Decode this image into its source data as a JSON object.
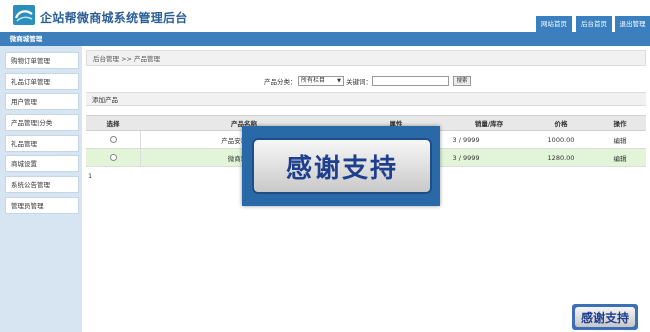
{
  "header": {
    "title": "企站帮微商城系统管理后台",
    "buttons": [
      "网站首页",
      "后台首页",
      "退出管理"
    ]
  },
  "nav": {
    "current": "微商城管理"
  },
  "sidebar": {
    "items": [
      {
        "label": "购物订单管理"
      },
      {
        "label": "礼品订单管理"
      },
      {
        "label": "用户管理"
      },
      {
        "label": "产品管理|分类"
      },
      {
        "label": "礼品管理"
      },
      {
        "label": "商城设置"
      },
      {
        "label": "系统公告管理"
      },
      {
        "label": "管理员管理"
      }
    ]
  },
  "breadcrumb": "后台管理 >> 产品管理",
  "search": {
    "category_label": "产品分类：",
    "category_value": "所有栏目",
    "keyword_label": "关键词：",
    "keyword_value": "",
    "button": "搜索"
  },
  "add_product_label": "添加产品",
  "table": {
    "headers": [
      "选择",
      "产品名称",
      "属性",
      "销量/库存",
      "价格",
      "操作"
    ],
    "rows": [
      {
        "name": "产品安装套餐包",
        "attr": "",
        "stock": "3 / 9999",
        "price": "1000.00",
        "action": "编辑"
      },
      {
        "name": "微商城系统",
        "attr": "",
        "stock": "3 / 9999",
        "price": "1280.00",
        "action": "编辑"
      }
    ]
  },
  "pager": "1",
  "overlay_text": "感谢支持",
  "badge_text": "感谢支持",
  "colors": {
    "brand": "#3d7fbd",
    "title": "#2b5f96",
    "row_highlight": "#e3f5d8"
  }
}
